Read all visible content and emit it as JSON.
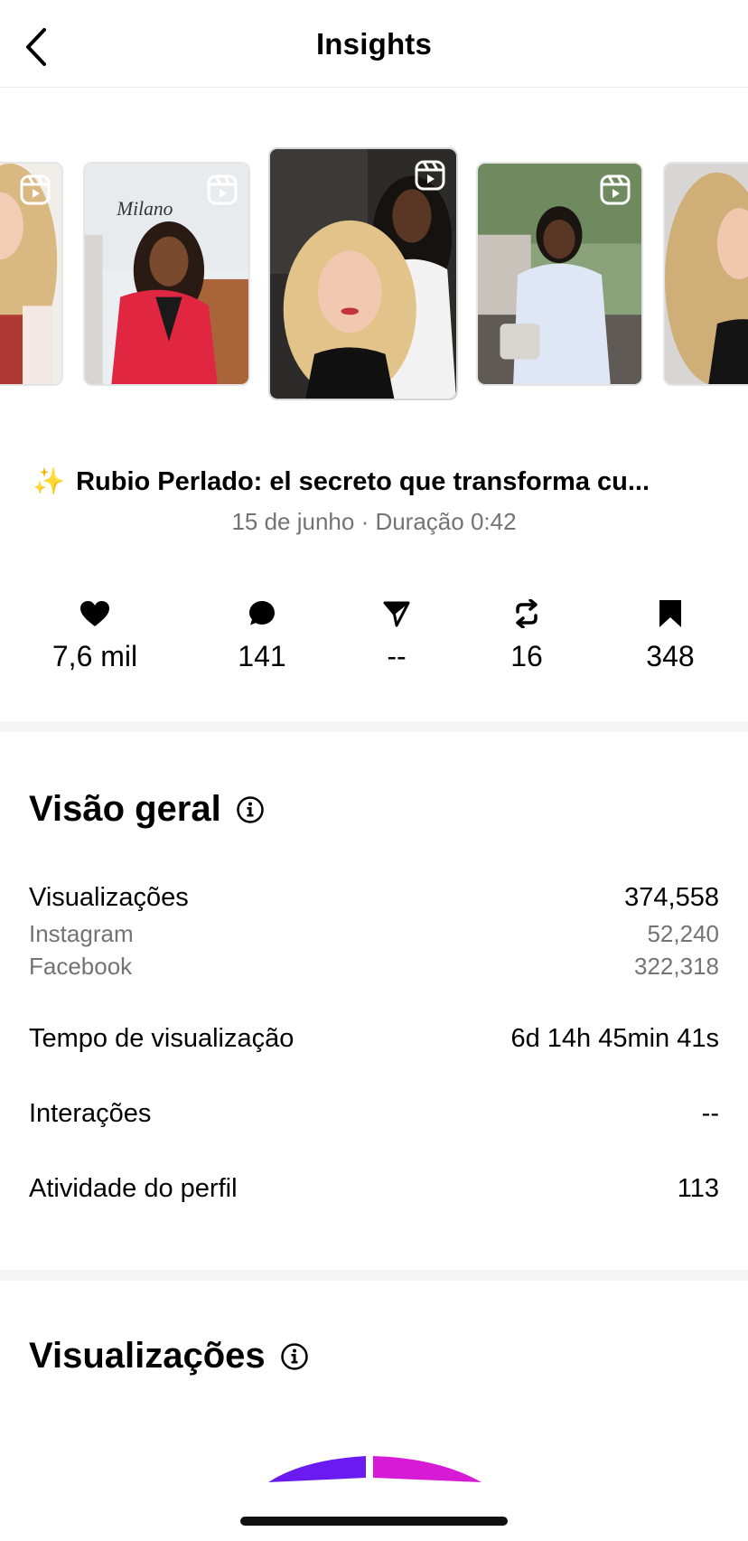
{
  "header": {
    "title": "Insights",
    "back_icon": "chevron-left-icon"
  },
  "reel": {
    "caption": "Rubio Perlado: el secreto que transforma cu...",
    "caption_emoji": "✨",
    "meta": "15 de junho · Duração 0:42"
  },
  "stats": [
    {
      "icon": "heart-icon",
      "value": "7,6 mil"
    },
    {
      "icon": "comment-icon",
      "value": "141"
    },
    {
      "icon": "send-icon",
      "value": "--"
    },
    {
      "icon": "repost-icon",
      "value": "16"
    },
    {
      "icon": "bookmark-icon",
      "value": "348"
    }
  ],
  "overview": {
    "title": "Visão geral",
    "rows": {
      "views": {
        "label": "Visualizações",
        "value": "374,558"
      },
      "instagram": {
        "label": "Instagram",
        "value": "52,240"
      },
      "facebook": {
        "label": "Facebook",
        "value": "322,318"
      },
      "watch_time": {
        "label": "Tempo de visualização",
        "value": "6d 14h 45min 41s"
      },
      "interactions": {
        "label": "Interações",
        "value": "--"
      },
      "profile_activity": {
        "label": "Atividade do perfil",
        "value": "113"
      }
    }
  },
  "views_section": {
    "title": "Visualizações"
  },
  "colors": {
    "accent_purple": "#6a1bf0",
    "accent_magenta": "#d61ad6",
    "muted_text": "#737373"
  }
}
